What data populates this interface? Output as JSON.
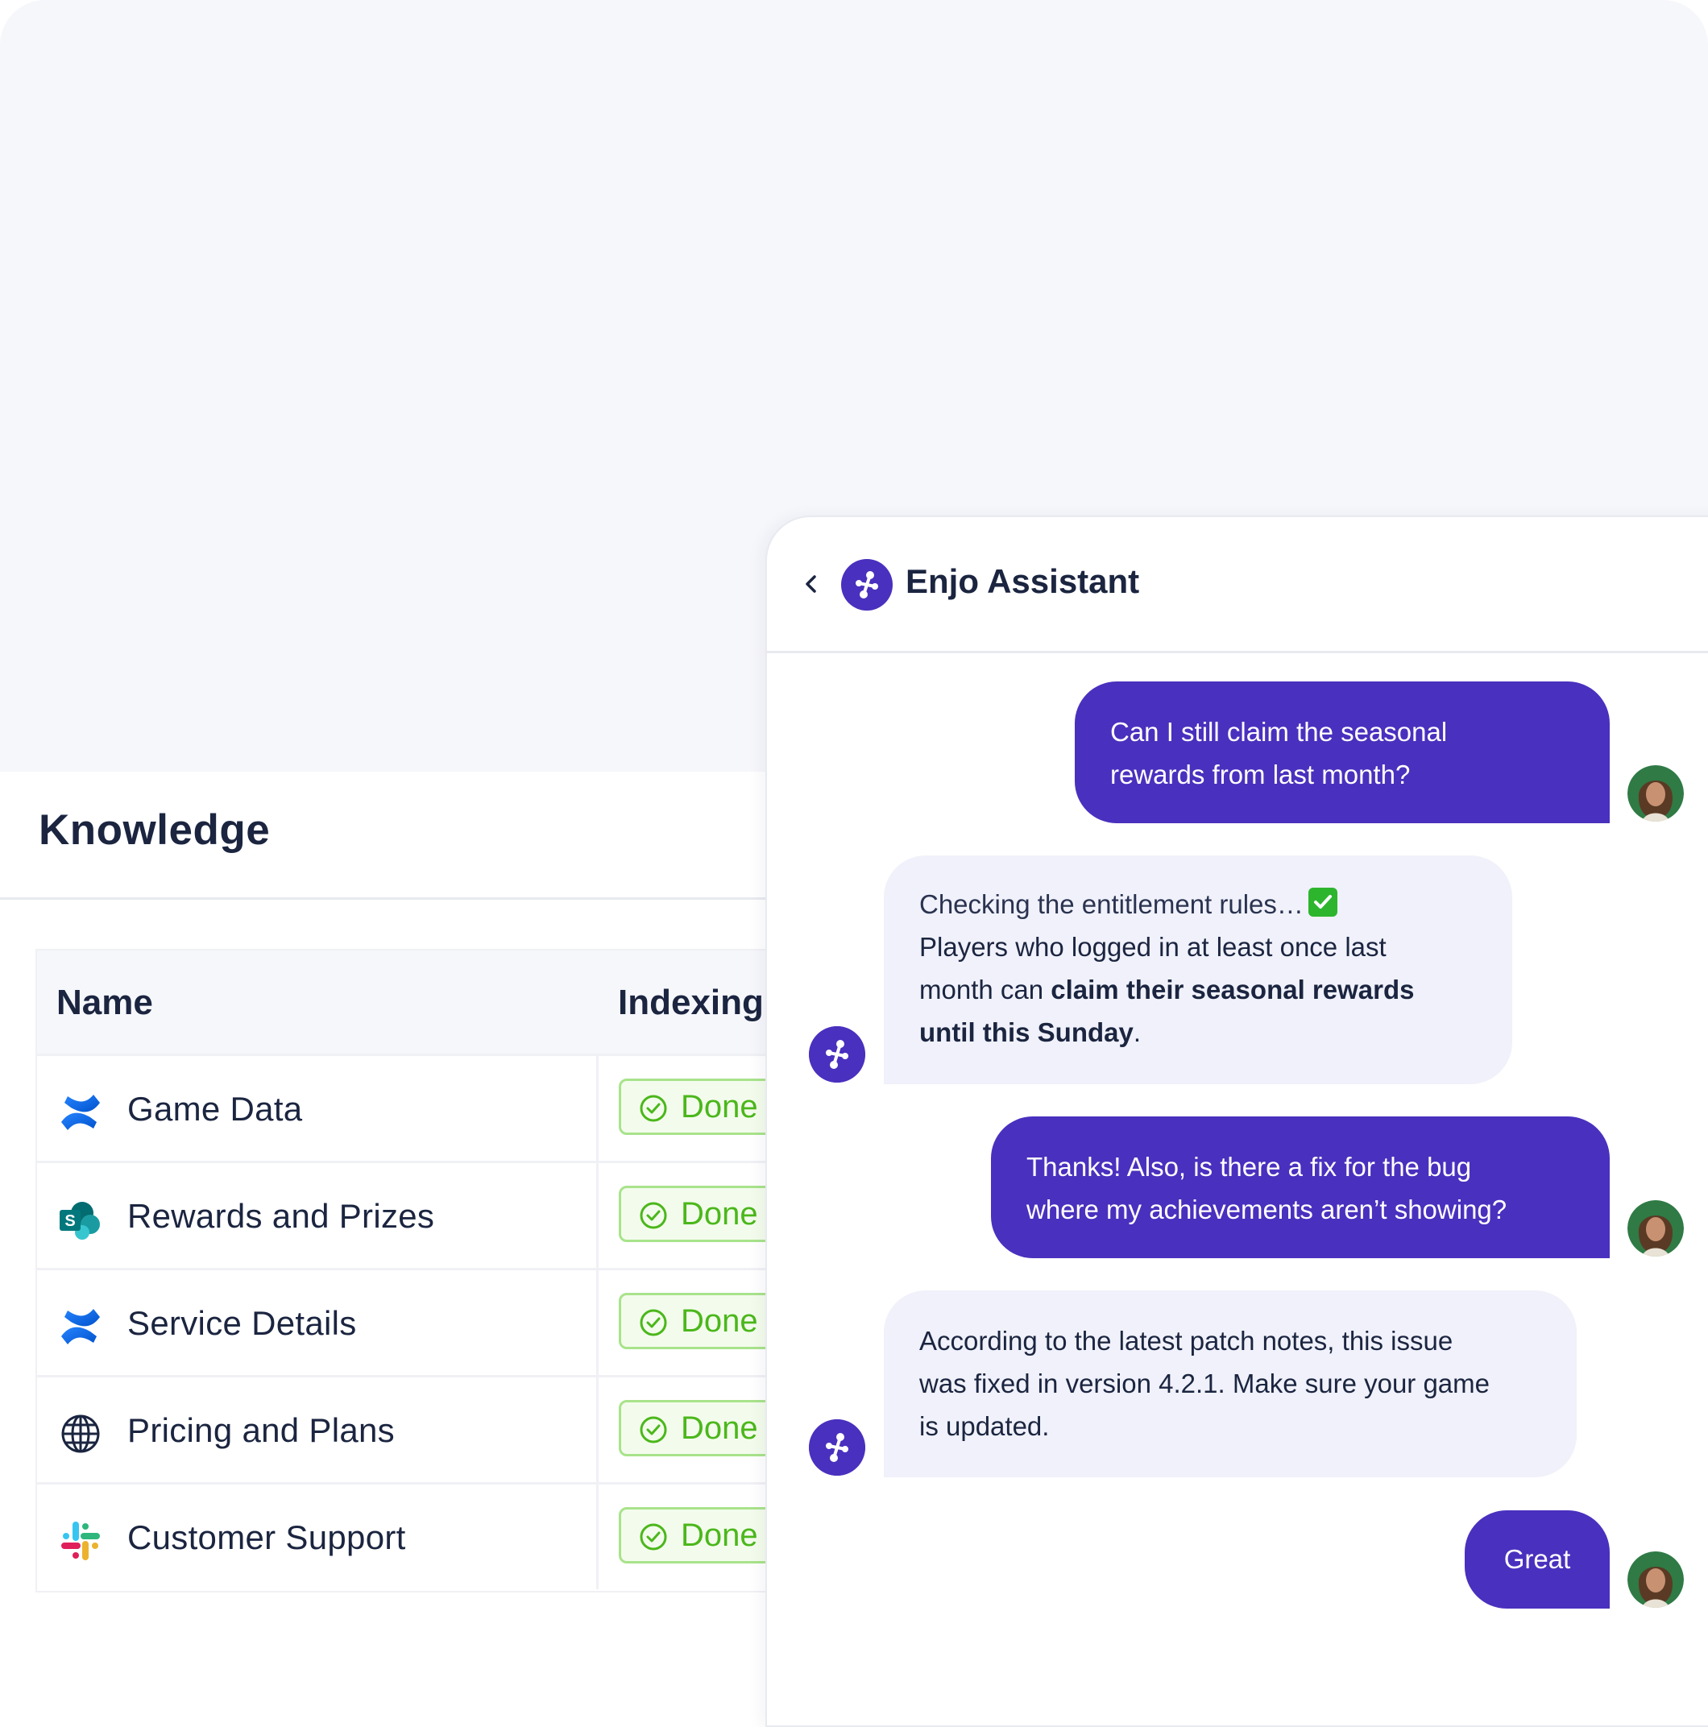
{
  "knowledge": {
    "title": "Knowledge",
    "columns": {
      "name": "Name",
      "indexing": "Indexing"
    },
    "rows": [
      {
        "name": "Game Data",
        "status": "Done",
        "icon": "confluence-icon"
      },
      {
        "name": "Rewards and Prizes",
        "status": "Done",
        "icon": "sharepoint-icon"
      },
      {
        "name": "Service Details",
        "status": "Done",
        "icon": "confluence-icon"
      },
      {
        "name": "Pricing and Plans",
        "status": "Done",
        "icon": "globe-icon"
      },
      {
        "name": "Customer Support",
        "status": "Done",
        "icon": "slack-icon"
      }
    ]
  },
  "chat": {
    "assistant_name": "Enjo Assistant",
    "messages": [
      {
        "from": "user",
        "lines": [
          "Can I still claim the seasonal",
          "rewards from last month?"
        ]
      },
      {
        "from": "assistant",
        "checking": "Checking the entitlement rules…",
        "line1": "Players who logged in at least once last",
        "line2_plain": "month can ",
        "line2_bold": "claim their seasonal rewards",
        "line3_bold": "until this Sunday",
        "line3_end": "."
      },
      {
        "from": "user",
        "lines": [
          "Thanks! Also, is there a fix for the bug",
          "where my achievements aren’t showing?"
        ]
      },
      {
        "from": "assistant",
        "lines": [
          "According to the latest patch notes, this issue",
          "was fixed in version 4.2.1. Make sure your game",
          "is updated."
        ]
      },
      {
        "from": "user",
        "lines": [
          "Great"
        ]
      }
    ]
  },
  "colors": {
    "brand": "#4a30be",
    "status_done": "#4bb71b",
    "bot_bubble": "#f0f1fa"
  }
}
